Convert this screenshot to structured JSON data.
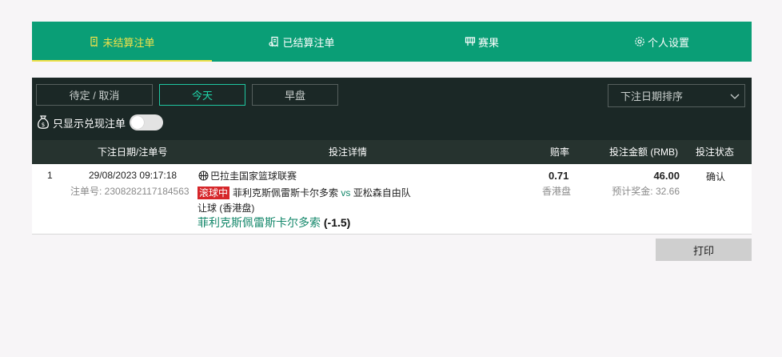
{
  "nav": {
    "tabs": [
      {
        "label": "未结算注单",
        "icon": "receipt-icon",
        "active": true
      },
      {
        "label": "已结算注单",
        "icon": "settled-receipt-icon",
        "active": false
      },
      {
        "label": "赛果",
        "icon": "results-icon",
        "active": false
      },
      {
        "label": "个人设置",
        "icon": "gear-icon",
        "active": false
      }
    ]
  },
  "filters": {
    "pending_label": "待定 / 取消",
    "today_label": "今天",
    "early_label": "早盘",
    "sort_value": "下注日期排序",
    "cashout_label": "只显示兑现注单",
    "cashout_enabled": false
  },
  "table": {
    "headers": {
      "date": "下注日期/注单号",
      "details": "投注详情",
      "odds": "赔率",
      "stake": "投注金额 (RMB)",
      "status": "投注状态"
    },
    "rows": [
      {
        "index": "1",
        "datetime": "29/08/2023 09:17:18",
        "bet_no_label": "注单号: 2308282117184563",
        "league": "巴拉圭国家篮球联赛",
        "inplay_badge": "滚球中",
        "home": "菲利克斯佩雷斯卡尔多索",
        "vs": "vs",
        "away": "亚松森自由队",
        "market": "让球 (香港盘)",
        "selection": "菲利克斯佩雷斯卡尔多索",
        "handicap": "(-1.5)",
        "odds": "0.71",
        "odds_type": "香港盘",
        "stake": "46.00",
        "est_win": "预计奖金: 32.66",
        "status": "确认"
      }
    ]
  },
  "print_label": "打印",
  "colors": {
    "brand_green": "#0a9e76",
    "active_tab": "#f2e24a",
    "panel_dark": "#1b2826",
    "header_dark": "#26332f",
    "accent_teal": "#1fd6aa",
    "inplay_red": "#d6262a"
  }
}
